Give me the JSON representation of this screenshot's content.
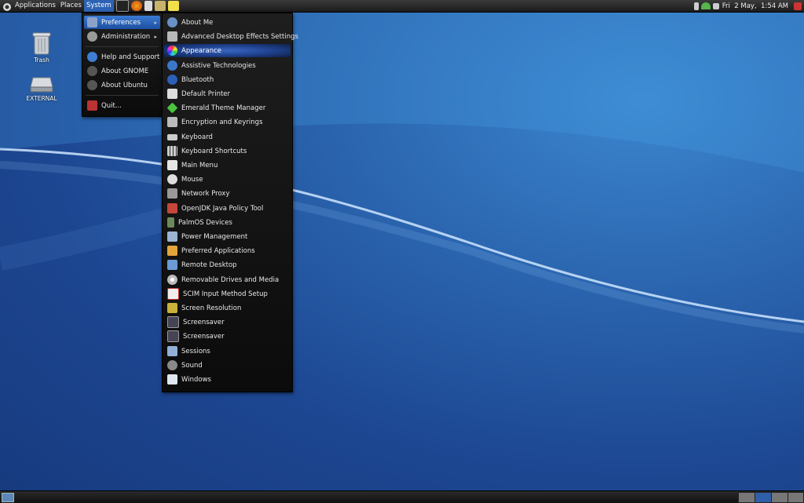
{
  "top_panel": {
    "menus": [
      "Applications",
      "Places",
      "System"
    ],
    "clock": "Fri  2 May,  1:54 AM"
  },
  "desktop": {
    "icons": [
      {
        "label": "Trash",
        "icon": "trash-icon"
      },
      {
        "label": "EXTERNAL",
        "icon": "drive-icon"
      }
    ]
  },
  "system_menu": {
    "items": [
      {
        "label": "Preferences",
        "icon": "preferences-icon",
        "submenu": true,
        "selected": true
      },
      {
        "label": "Administration",
        "icon": "gear-icon",
        "submenu": true
      },
      {
        "label": "Help and Support",
        "icon": "help-icon"
      },
      {
        "label": "About GNOME",
        "icon": "gnome-icon"
      },
      {
        "label": "About Ubuntu",
        "icon": "ubuntu-icon"
      },
      {
        "label": "Quit...",
        "icon": "quit-icon"
      }
    ]
  },
  "preferences_menu": {
    "items": [
      {
        "label": "About Me",
        "icon": "about-me-icon"
      },
      {
        "label": "Advanced Desktop Effects Settings",
        "icon": "effects-icon"
      },
      {
        "label": "Appearance",
        "icon": "appearance-icon",
        "highlighted": true
      },
      {
        "label": "Assistive Technologies",
        "icon": "accessibility-icon"
      },
      {
        "label": "Bluetooth",
        "icon": "bluetooth-icon"
      },
      {
        "label": "Default Printer",
        "icon": "printer-icon"
      },
      {
        "label": "Emerald Theme Manager",
        "icon": "emerald-icon"
      },
      {
        "label": "Encryption and Keyrings",
        "icon": "keyring-icon"
      },
      {
        "label": "Keyboard",
        "icon": "keyboard-icon"
      },
      {
        "label": "Keyboard Shortcuts",
        "icon": "shortcuts-icon"
      },
      {
        "label": "Main Menu",
        "icon": "main-menu-icon"
      },
      {
        "label": "Mouse",
        "icon": "mouse-icon"
      },
      {
        "label": "Network Proxy",
        "icon": "network-proxy-icon"
      },
      {
        "label": "OpenJDK Java  Policy Tool",
        "icon": "java-icon"
      },
      {
        "label": "PalmOS Devices",
        "icon": "palm-icon"
      },
      {
        "label": "Power Management",
        "icon": "power-icon"
      },
      {
        "label": "Preferred Applications",
        "icon": "preferred-apps-icon"
      },
      {
        "label": "Remote Desktop",
        "icon": "remote-desktop-icon"
      },
      {
        "label": "Removable Drives and Media",
        "icon": "removable-media-icon"
      },
      {
        "label": "SCIM Input Method Setup",
        "icon": "scim-icon"
      },
      {
        "label": "Screen Resolution",
        "icon": "screen-resolution-icon"
      },
      {
        "label": "Screensaver",
        "icon": "screensaver-icon"
      },
      {
        "label": "Screensaver",
        "icon": "screensaver-icon"
      },
      {
        "label": "Sessions",
        "icon": "sessions-icon"
      },
      {
        "label": "Sound",
        "icon": "sound-icon"
      },
      {
        "label": "Windows",
        "icon": "windows-icon"
      }
    ]
  },
  "colors": {
    "panel": "#1b1b1b",
    "menu_selected": "#2d62b3",
    "wallpaper": "#2a63ad"
  }
}
